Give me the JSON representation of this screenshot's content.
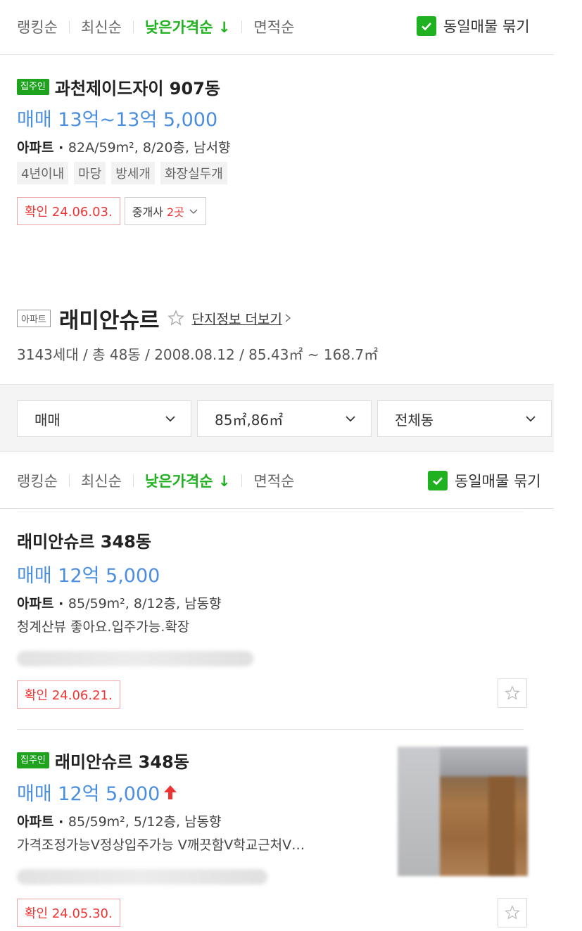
{
  "sort_top": {
    "options": [
      "랭킹순",
      "최신순",
      "낮은가격순 ↓",
      "면적순"
    ],
    "active_index": 2,
    "group_label": "동일매물 묶기"
  },
  "listing_1": {
    "owner_badge": "집주인",
    "title": "과천제이드자이 907동",
    "price": "매매 13억~13억 5,000",
    "type": "아파트",
    "specs": "82A/59m², 8/20층, 남서향",
    "tags": [
      "4년이내",
      "마당",
      "방세개",
      "화장실두개"
    ],
    "confirm": "확인 24.06.03.",
    "agent_label": "중개사",
    "agent_count": "2곳"
  },
  "complex": {
    "badge": "아파트",
    "name": "래미안슈르",
    "detail_link": "단지정보 더보기",
    "meta": "3143세대 / 총 48동 / 2008.08.12 / 85.43㎡ ~ 168.7㎡"
  },
  "filters": {
    "trade": "매매",
    "area": "85㎡,86㎡",
    "dong": "전체동"
  },
  "sort_bottom": {
    "options": [
      "랭킹순",
      "최신순",
      "낮은가격순 ↓",
      "면적순"
    ],
    "active_index": 2,
    "group_label": "동일매물 묶기"
  },
  "listing_2": {
    "title": "래미안슈르 348동",
    "price": "매매 12억 5,000",
    "type": "아파트",
    "specs": "85/59m², 8/12층, 남동향",
    "desc": "청계산뷰 좋아요.입주가능.확장",
    "confirm": "확인 24.06.21."
  },
  "listing_3": {
    "owner_badge": "집주인",
    "title": "래미안슈르 348동",
    "price": "매매 12억 5,000",
    "type": "아파트",
    "specs": "85/59m², 5/12층, 남동향",
    "desc": "가격조정가능V정상입주가능 V깨끗함V학교근처V…",
    "confirm": "확인 24.05.30."
  },
  "colors": {
    "accent_green": "#1fb11f",
    "price_blue": "#4a8ee0",
    "confirm_red": "#e33333"
  }
}
